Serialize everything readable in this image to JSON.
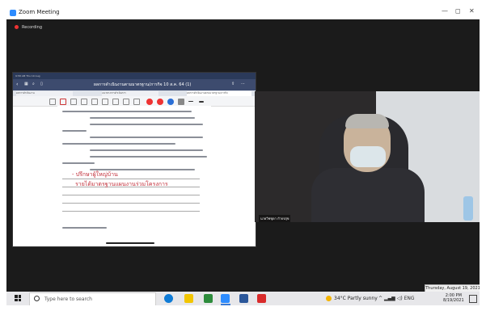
{
  "window": {
    "title": "Zoom Meeting",
    "minimize": "—",
    "maximize": "◻",
    "close": "✕"
  },
  "recording": {
    "label": "Recording"
  },
  "share": {
    "status_left": "9:58 AM  Thu 19 Aug",
    "doc_title": "ผลการดำเนินงานตามมาตรฐาน/ภารกิจ 10 ส.ค. 64 (1)",
    "tabs": [
      "ผลการดำเนินงาน",
      "แนวทางการดำเนินการ",
      "ผลการดำเนินงานตามมาตรฐาน/ภารกิจ"
    ],
    "handwriting_1": "- ปรึกษาผู้ใหญ่บ้าน",
    "handwriting_2": "รายได้มาตรฐานแผนงานร่วมโครงการ"
  },
  "video": {
    "participant_label": "นายวิชชุดา กำจรสุข"
  },
  "tooltip_date": "Thursday, August 19, 2021",
  "taskbar": {
    "search_placeholder": "Type here to search",
    "weather": "34°C  Partly sunny",
    "time": "2:00 PM",
    "date": "8/19/2021",
    "tray_text": "ENG"
  }
}
